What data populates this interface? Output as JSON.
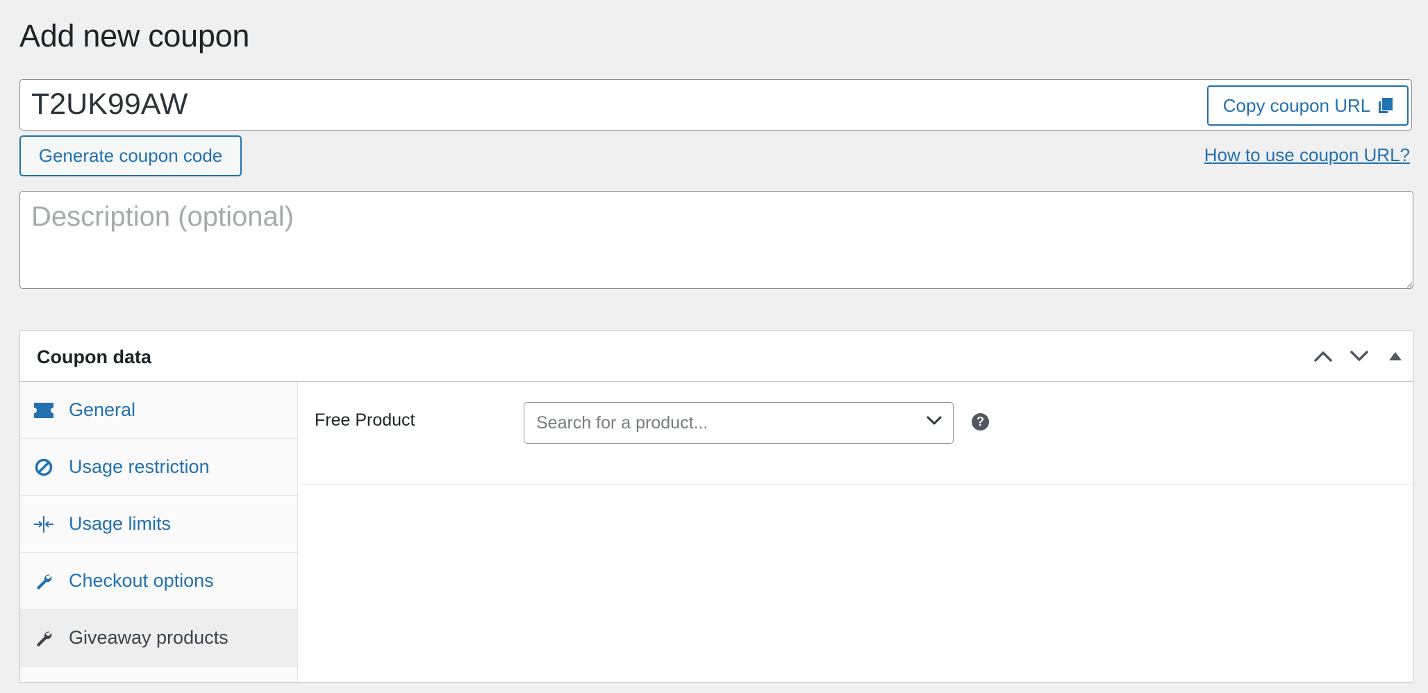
{
  "page": {
    "title": "Add new coupon"
  },
  "coupon": {
    "code": "T2UK99AW",
    "copy_url_label": "Copy coupon URL",
    "generate_label": "Generate coupon code",
    "howto_link": "How to use coupon URL?",
    "description_placeholder": "Description (optional)"
  },
  "panel": {
    "title": "Coupon data",
    "tabs": [
      {
        "label": "General",
        "icon": "ticket-icon"
      },
      {
        "label": "Usage restriction",
        "icon": "prohibited-icon"
      },
      {
        "label": "Usage limits",
        "icon": "limits-icon"
      },
      {
        "label": "Checkout options",
        "icon": "wrench-icon"
      },
      {
        "label": "Giveaway products",
        "icon": "wrench-icon",
        "active": true
      }
    ],
    "fields": {
      "free_product_label": "Free Product",
      "free_product_placeholder": "Search for a product...",
      "help_glyph": "?"
    }
  },
  "colors": {
    "accent": "#2271b1",
    "background": "#f0f0f1",
    "text": "#1d2327"
  }
}
